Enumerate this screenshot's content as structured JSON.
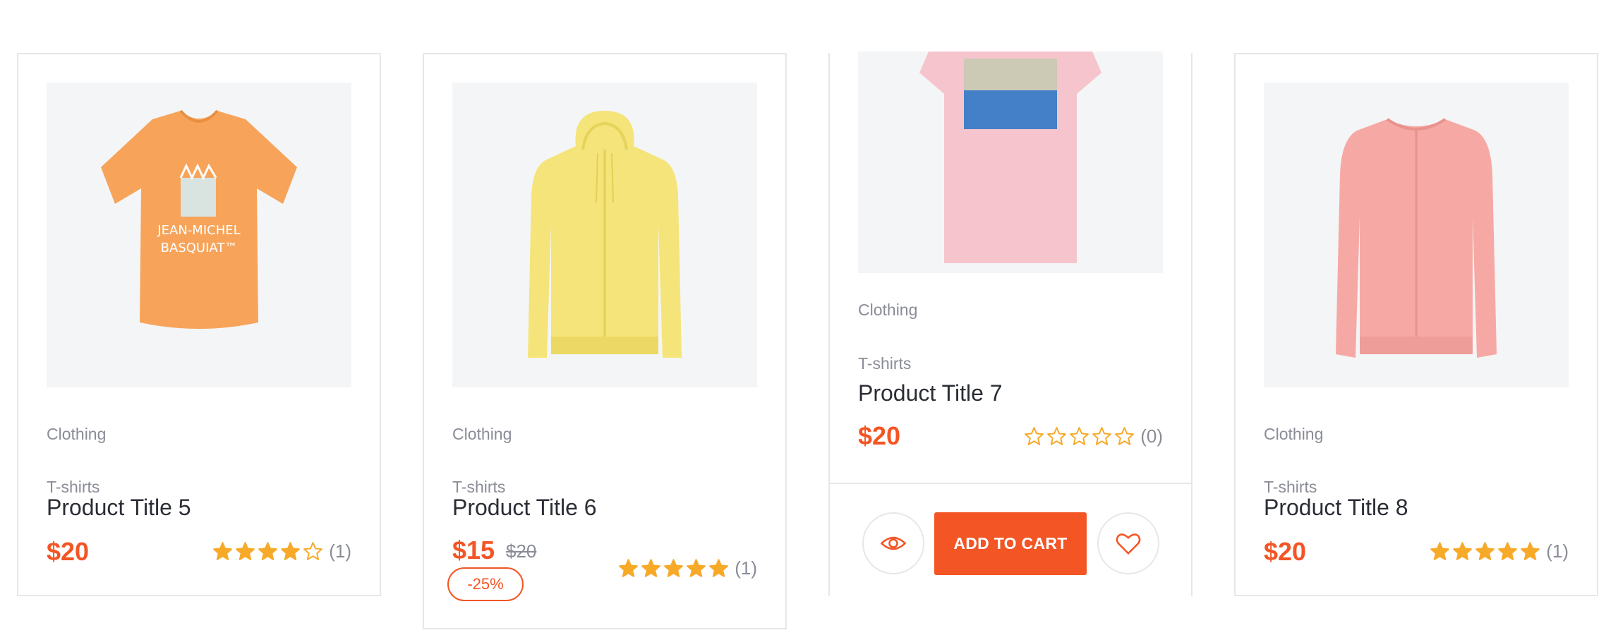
{
  "colors": {
    "accent": "#f35525",
    "star": "#f7a928",
    "muted": "#8a8c97",
    "border": "#e6e7eb"
  },
  "products": [
    {
      "category": "Clothing",
      "subcategory": "T-shirts",
      "title": "Product Title 5",
      "price": "$20",
      "rating": 4,
      "rating_count": "(1)",
      "image": "orange-tshirt-basquiat",
      "image_text": [
        "JEAN-MICHEL",
        "BASQUIAT™"
      ]
    },
    {
      "category": "Clothing",
      "subcategory": "T-shirts",
      "title": "Product Title 6",
      "price": "$15",
      "old_price": "$20",
      "discount": "-25%",
      "rating": 5,
      "rating_count": "(1)",
      "image": "yellow-hoodie"
    },
    {
      "category": "Clothing",
      "subcategory": "T-shirts",
      "title": "Product Title 7",
      "price": "$20",
      "rating": 0,
      "rating_count": "(0)",
      "image": "pink-tshirt-print",
      "add_to_cart_label": "ADD TO CART",
      "quick_view_icon": "eye-icon",
      "wishlist_icon": "heart-icon"
    },
    {
      "category": "Clothing",
      "subcategory": "T-shirts",
      "title": "Product Title 8",
      "price": "$20",
      "rating": 5,
      "rating_count": "(1)",
      "image": "pink-cardigan"
    }
  ]
}
